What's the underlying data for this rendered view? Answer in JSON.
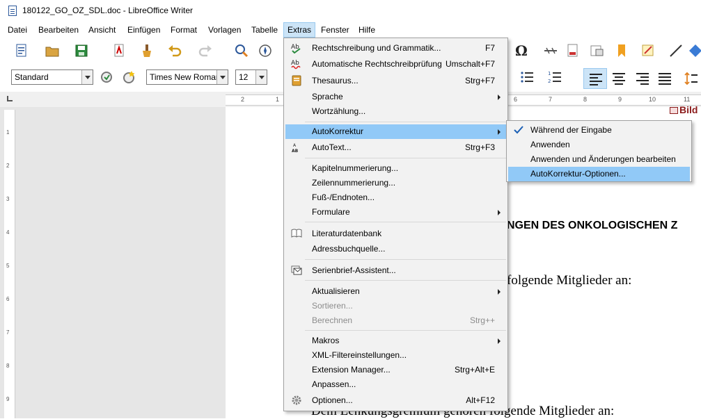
{
  "window": {
    "title": "180122_GO_OZ_SDL.doc - LibreOffice Writer"
  },
  "menubar": [
    {
      "label": "Datei"
    },
    {
      "label": "Bearbeiten"
    },
    {
      "label": "Ansicht"
    },
    {
      "label": "Einfügen"
    },
    {
      "label": "Format"
    },
    {
      "label": "Vorlagen"
    },
    {
      "label": "Tabelle"
    },
    {
      "label": "Extras"
    },
    {
      "label": "Fenster"
    },
    {
      "label": "Hilfe"
    }
  ],
  "formatting": {
    "paragraph_style": "Standard",
    "font_name": "Times New Roman",
    "font_size": "12"
  },
  "ruler": {
    "labels": [
      "2",
      "1",
      "6",
      "7",
      "8",
      "9",
      "10",
      "11"
    ],
    "vertical_labels": [
      "1",
      "2",
      "3",
      "4",
      "5",
      "6",
      "7",
      "8",
      "9"
    ]
  },
  "document": {
    "heading_fragment": "NGEN DES ONKOLOGISCHEN Z",
    "line1_fragment": "folgende Mitglieder an:",
    "line2": "Dem Lenkungsgremium gehören folgende Mitglieder an:",
    "image_label": "Bild"
  },
  "extras_menu": {
    "items": [
      {
        "label": "Rechtschreibung und Grammatik...",
        "shortcut": "F7"
      },
      {
        "label": "Automatische Rechtschreibprüfung",
        "shortcut": "Umschalt+F7"
      },
      {
        "label": "Thesaurus...",
        "shortcut": "Strg+F7"
      },
      {
        "label": "Sprache"
      },
      {
        "label": "Wortzählung..."
      },
      {
        "label": "AutoKorrektur"
      },
      {
        "label": "AutoText...",
        "shortcut": "Strg+F3"
      },
      {
        "label": "Kapitelnummerierung..."
      },
      {
        "label": "Zeilennummerierung..."
      },
      {
        "label": "Fuß-/Endnoten..."
      },
      {
        "label": "Formulare"
      },
      {
        "label": "Literaturdatenbank"
      },
      {
        "label": "Adressbuchquelle..."
      },
      {
        "label": "Serienbrief-Assistent..."
      },
      {
        "label": "Aktualisieren"
      },
      {
        "label": "Sortieren..."
      },
      {
        "label": "Berechnen",
        "shortcut": "Strg++"
      },
      {
        "label": "Makros"
      },
      {
        "label": "XML-Filtereinstellungen..."
      },
      {
        "label": "Extension Manager...",
        "shortcut": "Strg+Alt+E"
      },
      {
        "label": "Anpassen..."
      },
      {
        "label": "Optionen...",
        "shortcut": "Alt+F12"
      }
    ]
  },
  "autokorrektur_submenu": {
    "items": [
      {
        "label": "Während der Eingabe",
        "checked": true
      },
      {
        "label": "Anwenden"
      },
      {
        "label": "Anwenden und Änderungen bearbeiten"
      },
      {
        "label": "AutoKorrektur-Optionen..."
      }
    ]
  },
  "colors": {
    "highlight": "#91c9f7",
    "menu_bg": "#f2f2f2",
    "active_menubar": "#cce4f7"
  }
}
